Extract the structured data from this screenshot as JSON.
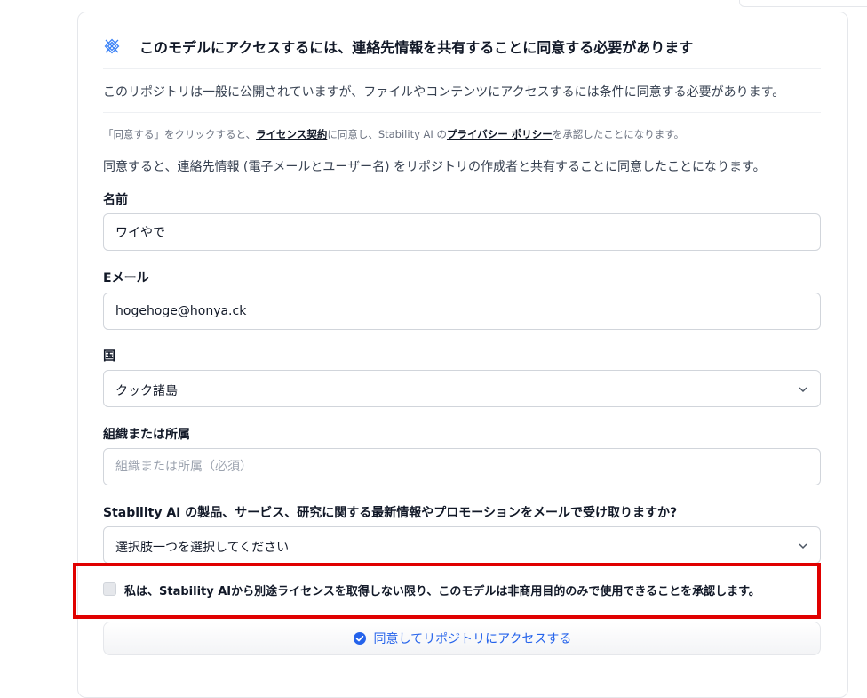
{
  "header": {
    "title": "このモデルにアクセスするには、連絡先情報を共有することに同意する必要があります"
  },
  "intro": "このリポジトリは一般に公開されていますが、ファイルやコンテンツにアクセスするには条件に同意する必要があります。",
  "notice": {
    "part1": "「同意する」をクリックすると、",
    "license_link": "ライセンス契約",
    "part2": "に同意し、Stability AI の",
    "privacy_link": "プライバシー ポリシー",
    "part3": "を承認したことになります。"
  },
  "share_notice": "同意すると、連絡先情報 (電子メールとユーザー名) をリポジトリの作成者と共有することに同意したことになります。",
  "form": {
    "name": {
      "label": "名前",
      "value": "ワイやで"
    },
    "email": {
      "label": "Eメール",
      "value": "hogehoge@honya.ck"
    },
    "country": {
      "label": "国",
      "value": "クック諸島"
    },
    "organization": {
      "label": "組織または所属",
      "placeholder": "組織または所属（必須）"
    },
    "marketing": {
      "label": "Stability AI の製品、サービス、研究に関する最新情報やプロモーションをメールで受け取りますか?",
      "value": "選択肢一つを選択してください"
    },
    "noncommercial": {
      "label": "私は、Stability AIから別途ライセンスを取得しない限り、このモデルは非商用目的のみで使用できることを承認します。"
    },
    "submit_label": "同意してリポジトリにアクセスする"
  },
  "colors": {
    "accent": "#2563eb",
    "highlight_border": "#e00000"
  },
  "icons": {
    "header": "gated-access-icon",
    "submit": "check-circle-icon",
    "select": "chevron-down-icon"
  }
}
